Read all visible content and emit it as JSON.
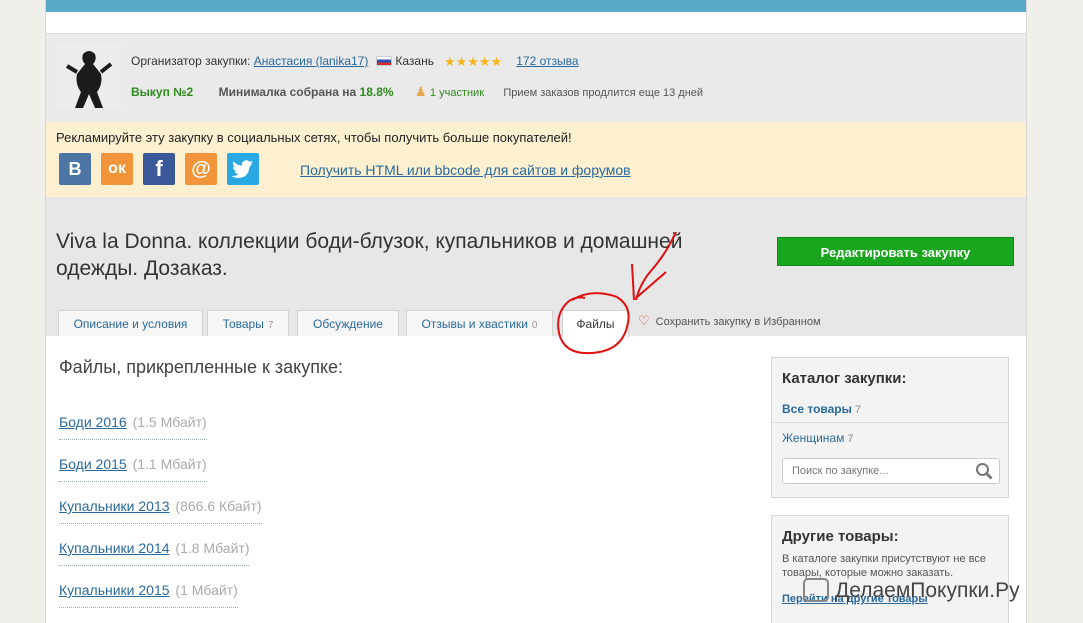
{
  "organizer": {
    "label": "Организатор закупки:",
    "name": "Анастасия (lanika17)",
    "city": "Казань",
    "stars": "★★★★★",
    "reviews": "172 отзыва",
    "batch": "Выкуп №2",
    "min_label": "Минималка собрана на",
    "min_value": "18.8%",
    "participants": "1 участник",
    "orders_note": "Прием заказов продлится еще 13 дней"
  },
  "social": {
    "text": "Рекламируйте эту закупку в социальных сетях, чтобы получить больше покупателей!",
    "html_link": "Получить HTML или bbcode для сайтов и форумов",
    "colors": {
      "vk": "#4c75a3",
      "ok": "#f2953a",
      "fb": "#3b5998",
      "mail": "#2e86c8",
      "tw": "#2aa8e3"
    }
  },
  "header": {
    "title": "Viva la Donna. коллекции боди-блузок, купальников и домашней одежды. Дозаказ.",
    "edit_button": "Редактировать закупку"
  },
  "tabs": [
    {
      "label": "Описание и условия",
      "count": ""
    },
    {
      "label": "Товары",
      "count": "7"
    },
    {
      "label": "Обсуждение",
      "count": ""
    },
    {
      "label": "Отзывы и хвастики",
      "count": "0"
    },
    {
      "label": "Файлы",
      "count": ""
    }
  ],
  "favorite": "Сохранить закупку в Избранном",
  "files": {
    "title": "Файлы, прикрепленные к закупке:",
    "items": [
      {
        "name": "Боди 2016",
        "size": "(1.5 Мбайт)"
      },
      {
        "name": "Боди 2015",
        "size": "(1.1 Мбайт)"
      },
      {
        "name": "Купальники 2013",
        "size": "(866.6 Кбайт)"
      },
      {
        "name": "Купальники 2014",
        "size": "(1.8 Мбайт)"
      },
      {
        "name": "Купальники 2015",
        "size": "(1 Мбайт)"
      }
    ]
  },
  "catalog": {
    "title": "Каталог закупки:",
    "all_label": "Все товары",
    "all_count": "7",
    "women_label": "Женщинам",
    "women_count": "7",
    "search_placeholder": "Поиск по закупке..."
  },
  "other": {
    "title": "Другие товары:",
    "text": "В каталоге закупки присутствуют не все товары, которые можно заказать.",
    "link": "Перейти на другие товары"
  },
  "watermark": "ДелаемПокупки.Ру"
}
